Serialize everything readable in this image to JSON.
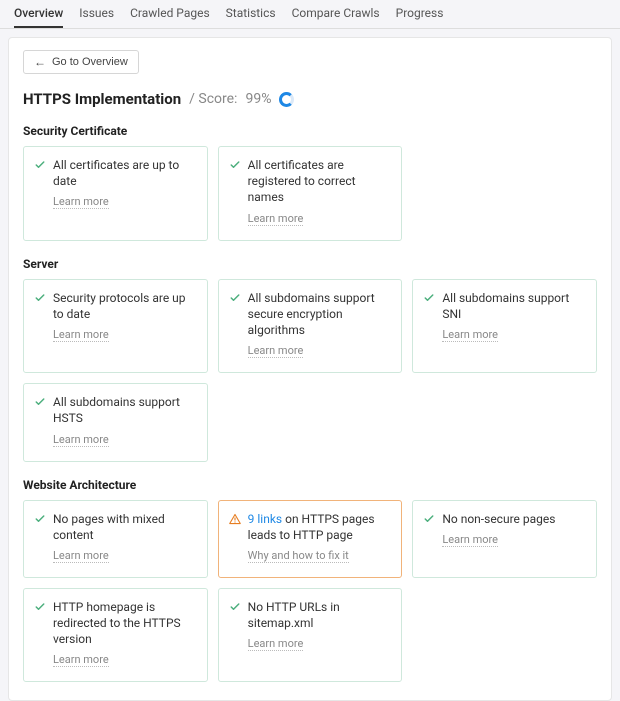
{
  "tabs": {
    "items": [
      "Overview",
      "Issues",
      "Crawled Pages",
      "Statistics",
      "Compare Crawls",
      "Progress"
    ],
    "active": 0
  },
  "back": {
    "label": "Go to Overview"
  },
  "header": {
    "title": "HTTPS Implementation",
    "score_label": "/ Score:",
    "score_value": "99%"
  },
  "sections": {
    "sec_cert": {
      "heading": "Security Certificate",
      "cards": [
        {
          "status": "ok",
          "text": "All certificates are up to date",
          "sub": "Learn more"
        },
        {
          "status": "ok",
          "text": "All certificates are registered to correct names",
          "sub": "Learn more"
        }
      ]
    },
    "server": {
      "heading": "Server",
      "cards": [
        {
          "status": "ok",
          "text": "Security protocols are up to date",
          "sub": "Learn more"
        },
        {
          "status": "ok",
          "text": "All subdomains support secure encryption algorithms",
          "sub": "Learn more"
        },
        {
          "status": "ok",
          "text": "All subdomains support SNI",
          "sub": "Learn more"
        },
        {
          "status": "ok",
          "text": "All subdomains support HSTS",
          "sub": "Learn more"
        }
      ]
    },
    "arch": {
      "heading": "Website Architecture",
      "cards": [
        {
          "status": "ok",
          "text": "No pages with mixed content",
          "sub": "Learn more"
        },
        {
          "status": "warn",
          "link": "9 links",
          "text": " on HTTPS pages leads to HTTP page",
          "sub": "Why and how to fix it"
        },
        {
          "status": "ok",
          "text": "No non-secure pages",
          "sub": "Learn more"
        },
        {
          "status": "ok",
          "text": "HTTP homepage is redirected to the HTTPS version",
          "sub": "Learn more"
        },
        {
          "status": "ok",
          "text": "No HTTP URLs in sitemap.xml",
          "sub": "Learn more"
        }
      ]
    }
  }
}
